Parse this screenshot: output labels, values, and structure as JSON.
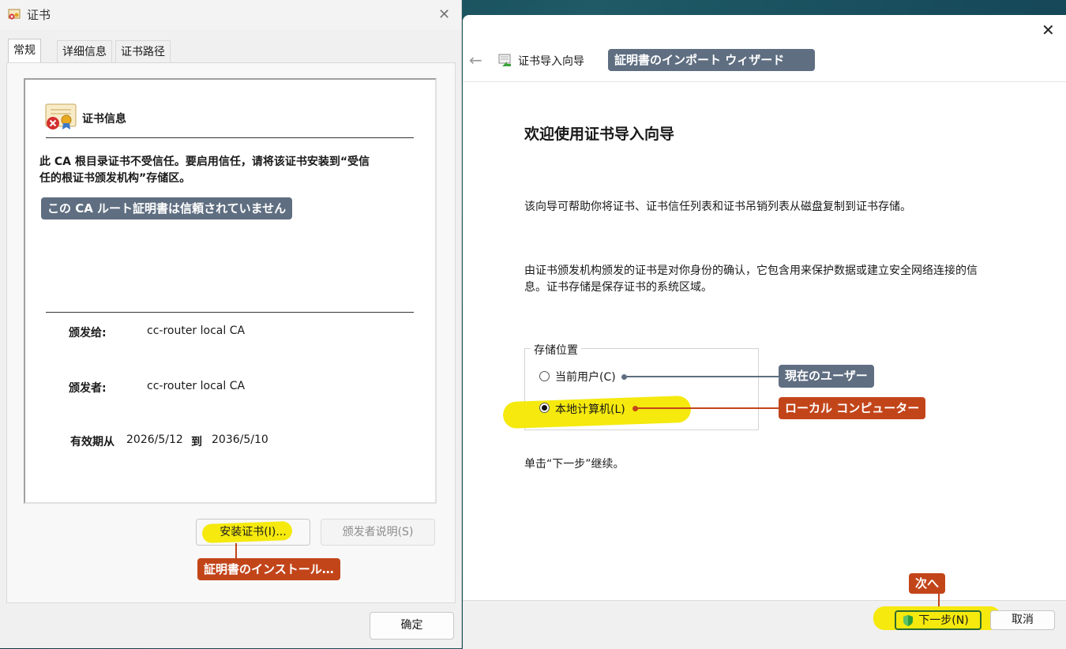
{
  "cert_dialog": {
    "title": "证书",
    "tabs": [
      "常规",
      "详细信息",
      "证书路径"
    ],
    "info_title": "证书信息",
    "warning": "此 CA 根目录证书不受信任。要启用信任，请将该证书安装到“受信任的根证书颁发机构”存储区。",
    "warning_line1": "此 CA 根目录证书不受信任。要启用信任，请将该证书安装到“受信",
    "warning_line2": "任的根证书颁发机构”存储区。",
    "issued_to_label": "颁发给:",
    "issued_to_value": "cc-router local CA",
    "issued_by_label": "颁发者:",
    "issued_by_value": "cc-router local CA",
    "valid_label": "有效期从",
    "valid_from": "2026/5/12",
    "valid_to_label": "到",
    "valid_to": "2036/5/10",
    "install_button": "安装证书(I)...",
    "issuer_statement_button": "颁发者说明(S)",
    "ok_button": "确定"
  },
  "wizard": {
    "back_icon": "arrow-left",
    "title": "证书导入向导",
    "heading": "欢迎使用证书导入向导",
    "para1": "该向导可帮助你将证书、证书信任列表和证书吊销列表从磁盘复制到证书存储。",
    "para2_line1": "由证书颁发机构颁发的证书是对你身份的确认，它包含用来保护数据或建立安全网络连接的信",
    "para2_line2": "息。证书存储是保存证书的系统区域。",
    "store_location_label": "存储位置",
    "radio_current_user": "当前用户(C)",
    "radio_local_machine": "本地计算机(L)",
    "selected": "local_machine",
    "continue_text": "单击“下一步”继续。",
    "next_button": "下一步(N)",
    "cancel_button": "取消"
  },
  "callouts": {
    "wizard_title": "証明書のインポート ウィザード",
    "untrusted": "この CA ルート証明書は信頼されていません",
    "install": "証明書のインストール…",
    "current_user": "現在のユーザー",
    "local_machine": "ローカル コンピューター",
    "next": "次へ"
  },
  "colors": {
    "callout_gray": "#5f6e81",
    "callout_orange": "#c2451a",
    "highlight": "#f4e800"
  }
}
